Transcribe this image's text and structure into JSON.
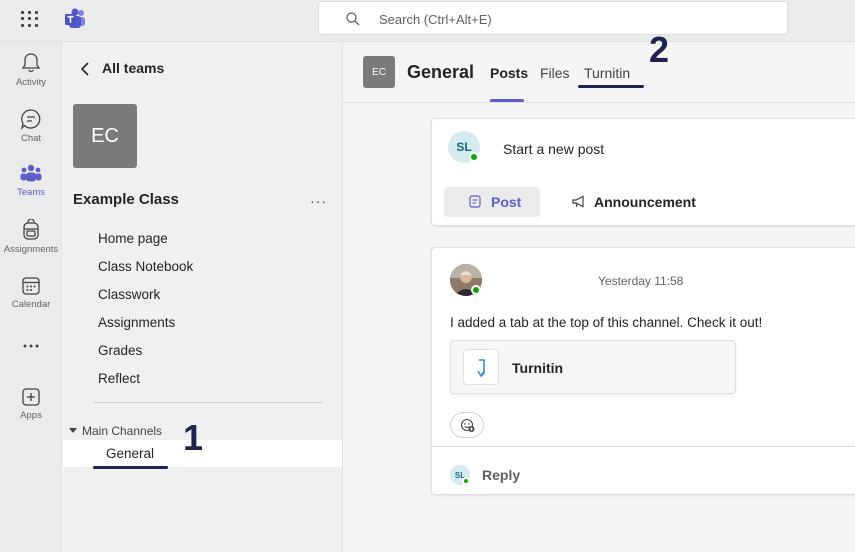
{
  "topbar": {
    "search_placeholder": "Search (Ctrl+Alt+E)"
  },
  "rail": {
    "items": [
      {
        "label": "Activity",
        "icon": "bell-icon"
      },
      {
        "label": "Chat",
        "icon": "chat-icon"
      },
      {
        "label": "Teams",
        "icon": "teams-icon",
        "active": true
      },
      {
        "label": "Assignments",
        "icon": "backpack-icon"
      },
      {
        "label": "Calendar",
        "icon": "calendar-icon"
      },
      {
        "label": "",
        "icon": "more-icon"
      },
      {
        "label": "Apps",
        "icon": "add-apps-icon"
      }
    ]
  },
  "team_pane": {
    "back_label": "All teams",
    "avatar_initials": "EC",
    "team_name": "Example Class",
    "more": "···",
    "links": [
      "Home page",
      "Class Notebook",
      "Classwork",
      "Assignments",
      "Grades",
      "Reflect"
    ],
    "channels_header": "Main Channels",
    "channels": [
      "General"
    ]
  },
  "annotations": {
    "one": "1",
    "two": "2"
  },
  "channel_header": {
    "avatar_initials": "EC",
    "title": "General",
    "tabs": [
      "Posts",
      "Files",
      "Turnitin"
    ],
    "active_tab": "Posts"
  },
  "new_post": {
    "avatar_initials": "SL",
    "prompt": "Start a new post",
    "post_label": "Post",
    "announcement_label": "Announcement"
  },
  "message": {
    "time": "Yesterday 11:58",
    "body": "I added a tab at the top of this channel. Check it out!",
    "tab_card_label": "Turnitin",
    "reply_avatar_initials": "SL",
    "reply_label": "Reply"
  },
  "colors": {
    "accent": "#5b5fc7",
    "annotation": "#1f2350",
    "presence": "#13a10e"
  }
}
